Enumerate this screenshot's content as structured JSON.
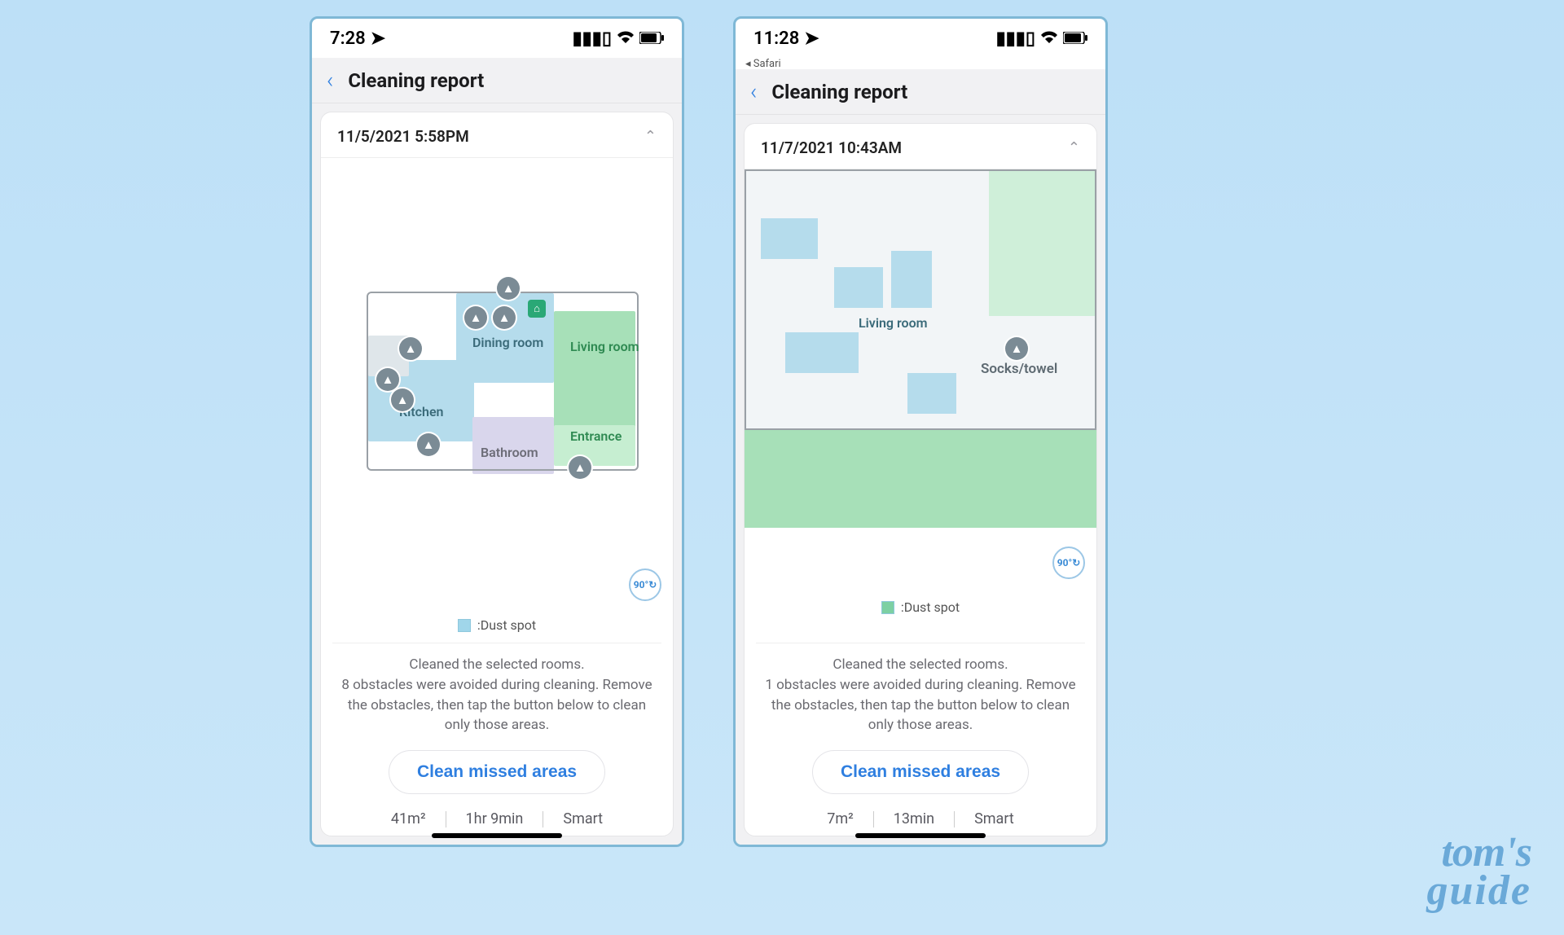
{
  "watermark": {
    "line1": "tom's",
    "line2": "guide"
  },
  "phones": [
    {
      "status": {
        "time": "7:28",
        "back_app": ""
      },
      "nav": {
        "title": "Cleaning report"
      },
      "card": {
        "date": "11/5/2021 5:58PM",
        "rooms": {
          "dining": "Dining room",
          "living": "Living room",
          "kitchen": "Kitchen",
          "bathroom": "Bathroom",
          "entrance": "Entrance"
        },
        "legend_label": ":Dust spot",
        "rotate_label": "90°",
        "summary_line1": "Cleaned the selected rooms.",
        "summary_line2": "8 obstacles were avoided during cleaning. Remove the obstacles, then tap the button below to clean only those areas.",
        "button": "Clean missed areas",
        "stats": {
          "area": "41m²",
          "time": "1hr 9min",
          "mode": "Smart"
        }
      }
    },
    {
      "status": {
        "time": "11:28",
        "back_app": "◂ Safari"
      },
      "nav": {
        "title": "Cleaning report"
      },
      "card": {
        "date": "11/7/2021 10:43AM",
        "rooms": {
          "living": "Living room",
          "socks": "Socks/towel"
        },
        "legend_label": ":Dust spot",
        "rotate_label": "90°",
        "summary_line1": "Cleaned the selected rooms.",
        "summary_line2": "1 obstacles were avoided during cleaning. Remove the obstacles, then tap the button below to clean only those areas.",
        "button": "Clean missed areas",
        "stats": {
          "area": "7m²",
          "time": "13min",
          "mode": "Smart"
        }
      }
    }
  ]
}
